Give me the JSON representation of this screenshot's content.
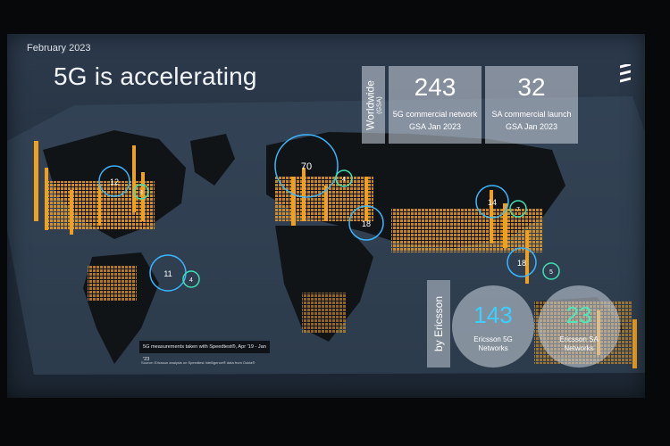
{
  "header": {
    "date": "February 2023",
    "title": "5G is accelerating"
  },
  "worldwide": {
    "label": "Worldwide",
    "sublabel": "(GSA)",
    "stats": [
      {
        "value": "243",
        "label": "5G commercial network",
        "source": "GSA Jan 2023"
      },
      {
        "value": "32",
        "label": "SA commercial launch",
        "source": "GSA Jan 2023"
      }
    ]
  },
  "by_ericsson": {
    "label": "by Ericsson",
    "stats": [
      {
        "value": "143",
        "label_line1": "Ericsson 5G",
        "label_line2": "Networks",
        "color": "#3ad0ff"
      },
      {
        "value": "23",
        "label_line1": "Ericsson SA",
        "label_line2": "Networks",
        "color": "#4ee8b8"
      }
    ]
  },
  "map_circles": [
    {
      "value": "12",
      "kind": "blue"
    },
    {
      "value": "3",
      "kind": "green"
    },
    {
      "value": "70",
      "kind": "blue"
    },
    {
      "value": "4",
      "kind": "green"
    },
    {
      "value": "18",
      "kind": "blue"
    },
    {
      "value": "14",
      "kind": "blue"
    },
    {
      "value": "7",
      "kind": "green"
    },
    {
      "value": "11",
      "kind": "blue"
    },
    {
      "value": "4",
      "kind": "green"
    },
    {
      "value": "18",
      "kind": "blue"
    },
    {
      "value": "5",
      "kind": "green"
    }
  ],
  "legend": {
    "text": "5G measurements taken with Speedtest®, Apr '19 - Jan '23",
    "source": "Source: Ericsson analysis on Speedtest Intelligence® data from Ookla®"
  },
  "colors": {
    "blue_ring": "#3ab6ff",
    "green_ring": "#3fe0b4",
    "spikes": "#f0a021"
  }
}
